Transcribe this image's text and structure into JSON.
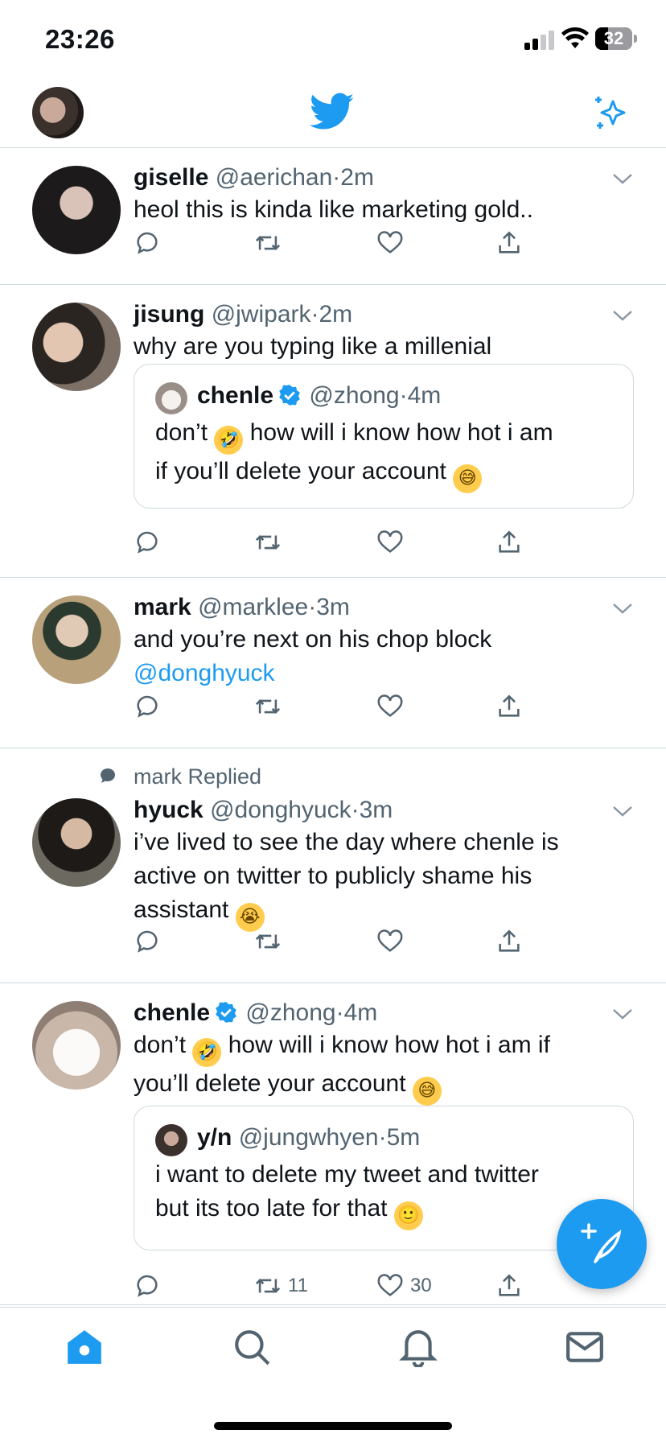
{
  "status": {
    "time": "23:26",
    "battery": "32"
  },
  "header": {
    "logo": "twitter-bird-icon",
    "sparkle": "sparkle-icon"
  },
  "colors": {
    "accent": "#1d9bf0",
    "secondary_text": "#536471",
    "divider": "#cfd9de"
  },
  "tweets": [
    {
      "name": "giselle",
      "handle": "@aerichan",
      "dot": "·",
      "time": "2m",
      "text": "heol this is kinda like marketing gold.."
    },
    {
      "name": "jisung",
      "handle": "@jwipark",
      "dot": "·",
      "time": "2m",
      "text": "why are you typing like a millenial",
      "quote": {
        "name": "chenle",
        "handle": "@zhong",
        "dot": "·",
        "time": "4m",
        "text_1": "don’t",
        "text_2": "how will i know how hot i am",
        "text_3": "if you’ll delete your account",
        "emoji_1": "🤣",
        "emoji_2": "😅"
      }
    },
    {
      "name": "mark",
      "handle": "@marklee",
      "dot": "·",
      "time": "3m",
      "text": "and you’re next on his chop block",
      "mention": "@donghyuck"
    },
    {
      "replied": "mark Replied",
      "name": "hyuck",
      "handle": "@donghyuck",
      "dot": "·",
      "time": "3m",
      "text_1": "i’ve lived to see the day where chenle is",
      "text_2": "active on twitter to publicly shame his",
      "text_3": "assistant",
      "emoji": "😭"
    },
    {
      "name": "chenle",
      "handle": "@zhong",
      "dot": "·",
      "time": "4m",
      "text_1": "don’t",
      "text_2": "how will i know how hot i am if",
      "text_3": "you’ll delete your account",
      "emoji_1": "🤣",
      "emoji_2": "😅",
      "quote": {
        "name": "y/n",
        "handle": "@jungwhyen",
        "dot": "·",
        "time": "5m",
        "text_1": "i want to delete my tweet and twitter",
        "text_2": "but its too late for that",
        "emoji": "🙂"
      },
      "retweets": "11",
      "likes": "30"
    }
  ],
  "nav": [
    "home-icon",
    "search-icon",
    "bell-icon",
    "mail-icon"
  ]
}
